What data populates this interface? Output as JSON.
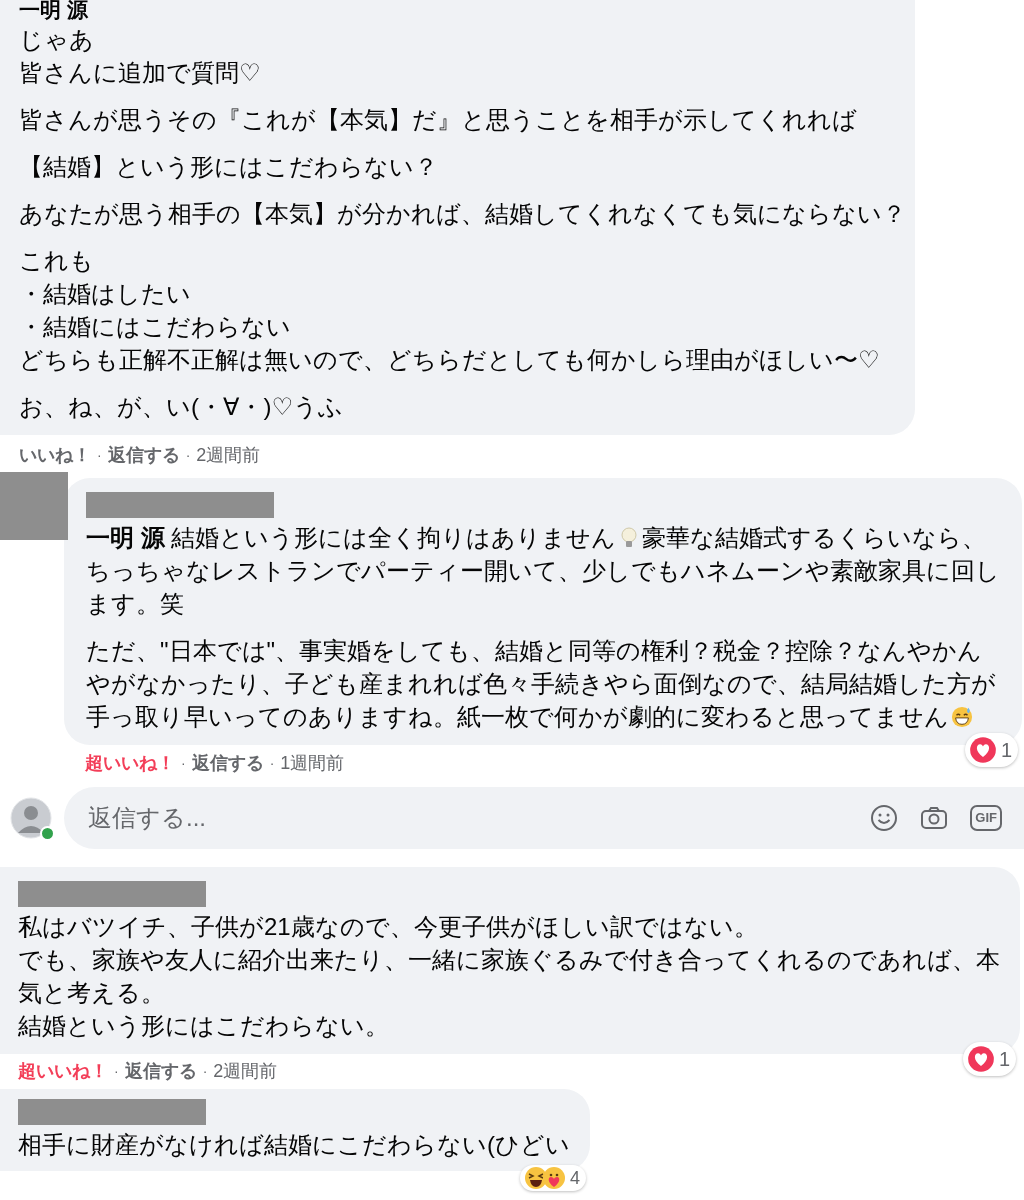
{
  "top_comment": {
    "author": "一明 源",
    "author_redacted": false,
    "paragraphs": [
      [
        "じゃあ",
        "皆さんに追加で質問♡"
      ],
      [
        "皆さんが思うその『これが【本気】だ』と思うことを相手が示してくれれば"
      ],
      [
        "【結婚】という形にはこだわらない？"
      ],
      [
        "あなたが思う相手の【本気】が分かれば、結婚してくれなくても気にならない？"
      ],
      [
        "これも",
        "・結婚はしたい",
        "・結婚にはこだわらない",
        "どちらも正解不正解は無いので、どちらだとしても何かしら理由がほしい〜♡"
      ],
      [
        "お、ね、が、い(・∀・)♡うふ"
      ]
    ],
    "footer": {
      "like": "いいね！",
      "liked": false,
      "sep1": "·",
      "reply": "返信する",
      "sep2": "·",
      "time": "2週間前"
    }
  },
  "reply": {
    "author_redacted": true,
    "paragraphs": [
      [
        {
          "kind": "mention",
          "text": "一明 源"
        },
        {
          "kind": "text",
          "text": "結婚という形には全く拘りはありません"
        },
        {
          "kind": "bulb"
        },
        {
          "kind": "text",
          "text": "豪華な結婚式するくらいなら、ちっちゃなレストランでパーティー開いて、少しでもハネムーンや素敵家具に回します。笑"
        }
      ],
      [
        {
          "kind": "text",
          "text": "ただ、\"日本では\"、事実婚をしても、結婚と同等の権利？税金？控除？なんやかんやがなかったり、子ども産まれれば色々手続きやら面倒なので、結局結婚した方が手っ取り早いってのありますね。紙一枚で何かが劇的に変わると思ってません"
        },
        {
          "kind": "grin"
        }
      ]
    ],
    "reactions": {
      "items": [
        {
          "kind": "love"
        }
      ],
      "count": "1"
    },
    "footer": {
      "like": "超いいね！",
      "liked": true,
      "sep1": "·",
      "reply": "返信する",
      "sep2": "·",
      "time": "1週間前"
    }
  },
  "composer": {
    "placeholder": "返信する...",
    "online": true,
    "gif_label": "GIF"
  },
  "comments": [
    {
      "author_redacted": true,
      "paragraphs": [
        [
          "私はバツイチ、子供が21歳なので、今更子供がほしい訳ではない。",
          "でも、家族や友人に紹介出来たり、一緒に家族ぐるみで付き合ってくれるのであれば、本気と考える。",
          "結婚という形にはこだわらない。"
        ]
      ],
      "reactions": {
        "items": [
          {
            "kind": "love"
          }
        ],
        "count": "1"
      },
      "footer": {
        "like": "超いいね！",
        "liked": true,
        "sep1": "·",
        "reply": "返信する",
        "sep2": "·",
        "time": "2週間前"
      }
    },
    {
      "author_redacted": true,
      "paragraphs": [
        [
          "相手に財産がなければ結婚にこだわらない(ひどい"
        ]
      ],
      "reactions": {
        "items": [
          {
            "kind": "laugh"
          },
          {
            "kind": "care"
          }
        ],
        "count": "4"
      }
    }
  ]
}
